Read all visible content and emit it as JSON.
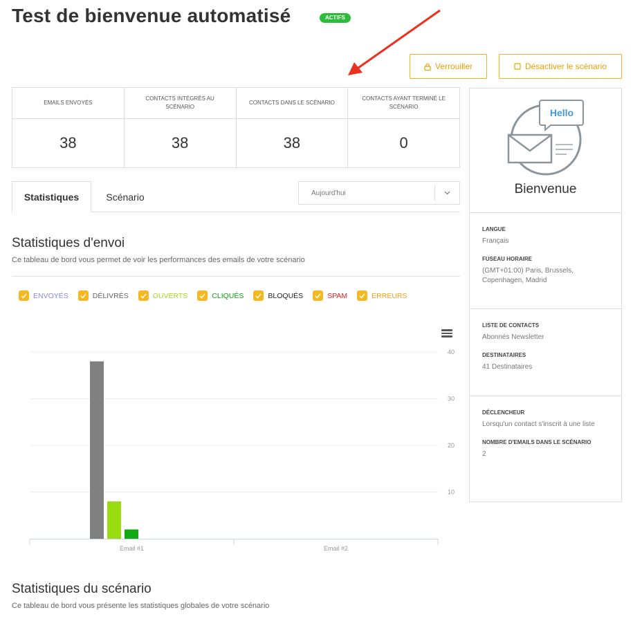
{
  "header": {
    "title": "Test de bienvenue automatisé",
    "status_badge": "ACTIFS"
  },
  "actions": {
    "lock_label": "Verrouiller",
    "deactivate_label": "Désactiver le scénario"
  },
  "stats": [
    {
      "label": "EMAILS ENVOYÉS",
      "value": "38"
    },
    {
      "label": "CONTACTS INTÉGRÉS AU SCÉNARIO",
      "value": "38"
    },
    {
      "label": "CONTACTS DANS LE SCÉNARIO",
      "value": "38"
    },
    {
      "label": "CONTACTS AYANT TERMINÉ LE SCÉNARIO",
      "value": "0"
    }
  ],
  "tabs": [
    {
      "label": "Statistiques",
      "active": true
    },
    {
      "label": "Scénario",
      "active": false
    }
  ],
  "period_select": {
    "value": "Aujourd'hui"
  },
  "send_stats": {
    "title": "Statistiques d'envoi",
    "description": "Ce tableau de bord vous permet de voir les performances des emails de votre scénario"
  },
  "legend": [
    {
      "label": "ENVOYÉS",
      "color": "#8b87e0",
      "checked": true
    },
    {
      "label": "DÉLIVRÉS",
      "color": "#666666",
      "checked": true
    },
    {
      "label": "OUVERTS",
      "color": "#a3d81c",
      "checked": true
    },
    {
      "label": "CLIQUÉS",
      "color": "#10a010",
      "checked": true
    },
    {
      "label": "BLOQUÉS",
      "color": "#222222",
      "checked": true
    },
    {
      "label": "SPAM",
      "color": "#e02020",
      "checked": true
    },
    {
      "label": "ERREURS",
      "color": "#f0a020",
      "checked": true
    }
  ],
  "chart_data": {
    "type": "bar",
    "categories": [
      "Email #1",
      "Email #2"
    ],
    "series": [
      {
        "name": "DÉLIVRÉS",
        "color": "#808080",
        "values": [
          38,
          0
        ]
      },
      {
        "name": "OUVERTS",
        "color": "#99dd11",
        "values": [
          8,
          0
        ]
      },
      {
        "name": "CLIQUÉS",
        "color": "#11aa11",
        "values": [
          2,
          0
        ]
      }
    ],
    "yticks": [
      "10",
      "20",
      "30",
      "40"
    ],
    "ylim": [
      0,
      40
    ],
    "y_axis_side": "right",
    "grid": true
  },
  "scenario_stats": {
    "title": "Statistiques du scénario",
    "description": "Ce tableau de bord vous présente les statistiques globales de votre scénario"
  },
  "sidebar": {
    "bubble_text": "Hello",
    "name": "Bienvenue",
    "sections": [
      {
        "fields": [
          {
            "label": "LANGUE",
            "value": "Français"
          },
          {
            "label": "FUSEAU HORAIRE",
            "value": "(GMT+01:00) Paris, Brussels, Copenhagen, Madrid"
          }
        ]
      },
      {
        "fields": [
          {
            "label": "LISTE DE CONTACTS",
            "value": "Abonnés Newsletter"
          },
          {
            "label": "DESTINATAIRES",
            "value": "41 Destinataires"
          }
        ]
      },
      {
        "fields": [
          {
            "label": "DÉCLENCHEUR",
            "value": "Lorsqu'un contact s'inscrit à une liste"
          },
          {
            "label": "NOMBRE D'EMAILS DANS LE SCÉNARIO",
            "value": "2"
          }
        ]
      }
    ]
  },
  "colors": {
    "accent": "#f2b41d",
    "active_badge": "#2bbd3a",
    "annotation_arrow": "#e8321e"
  }
}
